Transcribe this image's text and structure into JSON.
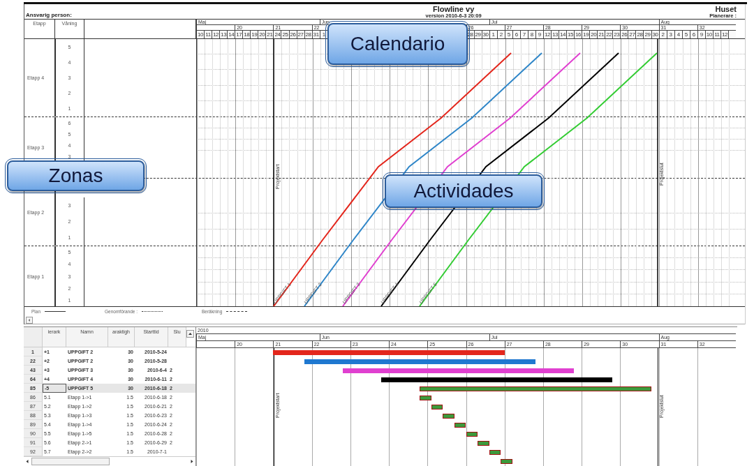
{
  "header": {
    "responsible": "Ansvarig person:",
    "title": "Flowline vy",
    "version": "version 2010-6-3 20:09",
    "project": "Huset",
    "planner": "Planerare :"
  },
  "flowline": {
    "columns": [
      "Etapp",
      "Våning"
    ],
    "months": [
      "Maj",
      "Jun",
      "Jul",
      "Aug"
    ],
    "weeks": [
      {
        "days": [
          "10",
          "11",
          "12",
          "13",
          "14"
        ]
      },
      {
        "label": "20",
        "days": [
          "17",
          "18",
          "19",
          "20",
          "21"
        ]
      },
      {
        "label": "21",
        "days": [
          "24",
          "25",
          "26",
          "27",
          "28"
        ]
      },
      {
        "label": "22",
        "days": [
          "31",
          "1"
        ]
      },
      {
        "label": "26",
        "days": [
          "28",
          "29",
          "30",
          "1",
          "2"
        ]
      },
      {
        "label": "27",
        "days": [
          "5",
          "6",
          "7",
          "8",
          "9"
        ]
      },
      {
        "label": "28",
        "days": [
          "12",
          "13",
          "14",
          "15",
          "16"
        ]
      },
      {
        "label": "29",
        "days": [
          "19",
          "20",
          "21",
          "22",
          "23"
        ]
      },
      {
        "label": "30",
        "days": [
          "26",
          "27",
          "28",
          "29",
          "30"
        ]
      },
      {
        "label": "31",
        "days": [
          "2",
          "3",
          "4",
          "5",
          "6"
        ]
      },
      {
        "label": "32",
        "days": [
          "9",
          "10",
          "11",
          "12"
        ]
      }
    ],
    "stages": [
      {
        "name": "Etapp 4",
        "floors": [
          "5",
          "4",
          "3",
          "2",
          "1"
        ]
      },
      {
        "name": "Etapp 3",
        "floors": [
          "6",
          "5",
          "4",
          "3"
        ]
      },
      {
        "name": "Etapp 2",
        "floors": [
          "3",
          "2",
          "1"
        ]
      },
      {
        "name": "Etapp 1",
        "floors": [
          "5",
          "4",
          "3",
          "2",
          "1"
        ]
      }
    ],
    "tasks": [
      {
        "name": "UPPGIFT 1",
        "color": "#e3261c"
      },
      {
        "name": "UPPGIFT 2",
        "color": "#2f86c8"
      },
      {
        "name": "UPPGIFT 3",
        "color": "#e040d0"
      },
      {
        "name": "UPPGIFT 4",
        "color": "#000000"
      },
      {
        "name": "UPPGIFT 5",
        "color": "#33cc33"
      }
    ],
    "milestones": [
      "Projektstart",
      "Projektslut"
    ],
    "legend": [
      {
        "label": "Plan",
        "kind": "solid"
      },
      {
        "label": "Genomförande :",
        "kind": "dotted"
      },
      {
        "label": "Beräkning",
        "kind": "dashed"
      }
    ]
  },
  "table": {
    "columns": [
      "ierark",
      "Namn",
      "araktigh",
      "Starttid",
      "Slu"
    ],
    "rows": [
      {
        "id": "1",
        "wbs": "+1",
        "name": "UPPGIFT 2",
        "duration": "30",
        "start": "2010-5-24",
        "kind": "summary",
        "selected": false
      },
      {
        "id": "22",
        "wbs": "+2",
        "name": "UPPGIFT 2",
        "duration": "30",
        "start": "2010-5-28",
        "kind": "summary",
        "selected": false
      },
      {
        "id": "43",
        "wbs": "+3",
        "name": "UPPGIFT 3",
        "duration": "30",
        "start": "2010-6-4",
        "end": "2",
        "kind": "summary",
        "selected": false
      },
      {
        "id": "64",
        "wbs": "+4",
        "name": "UPPGIFT 4",
        "duration": "30",
        "start": "2010-6-11",
        "end": "2",
        "kind": "summary",
        "selected": false
      },
      {
        "id": "85",
        "wbs": "-5",
        "name": "UPPGIFT 5",
        "duration": "30",
        "start": "2010-6-18",
        "end": "2",
        "kind": "summary",
        "selected": true
      },
      {
        "id": "86",
        "wbs": "5.1",
        "name": "Etapp 1->1",
        "duration": "1.5",
        "start": "2010-6-18",
        "end": "2",
        "kind": "task",
        "selected": false
      },
      {
        "id": "87",
        "wbs": "5.2",
        "name": "Etapp 1->2",
        "duration": "1.5",
        "start": "2010-6-21",
        "end": "2",
        "kind": "task",
        "selected": false
      },
      {
        "id": "88",
        "wbs": "5.3",
        "name": "Etapp 1->3",
        "duration": "1.5",
        "start": "2010-6-23",
        "end": "2",
        "kind": "task",
        "selected": false
      },
      {
        "id": "89",
        "wbs": "5.4",
        "name": "Etapp 1->4",
        "duration": "1.5",
        "start": "2010-6-24",
        "end": "2",
        "kind": "task",
        "selected": false
      },
      {
        "id": "90",
        "wbs": "5.5",
        "name": "Etapp 1->5",
        "duration": "1.5",
        "start": "2010-6-28",
        "end": "2",
        "kind": "task",
        "selected": false
      },
      {
        "id": "91",
        "wbs": "5.6",
        "name": "Etapp 2->1",
        "duration": "1.5",
        "start": "2010-6-29",
        "end": "2",
        "kind": "task",
        "selected": false
      },
      {
        "id": "92",
        "wbs": "5.7",
        "name": "Etapp 2->2",
        "duration": "1.5",
        "start": "2010-7-1",
        "kind": "task",
        "selected": false
      }
    ]
  },
  "gantt": {
    "year": "2010",
    "months": [
      "Maj",
      "Jun",
      "Jul",
      "Aug"
    ],
    "weeks": [
      "20",
      "21",
      "22",
      "23",
      "24",
      "25",
      "26",
      "27",
      "28",
      "29",
      "30",
      "31",
      "32"
    ],
    "milestones": [
      "Projektstart",
      "Projektslut"
    ],
    "bars": [
      {
        "color": "#e3261c",
        "kind": "summary"
      },
      {
        "color": "#1f78d0",
        "kind": "summary"
      },
      {
        "color": "#e040d0",
        "kind": "summary"
      },
      {
        "color": "#000000",
        "kind": "summary"
      },
      {
        "color": "#3c9a3c",
        "kind": "outlined"
      },
      {
        "color": "#3c9a3c",
        "kind": "outlined"
      },
      {
        "color": "#3c9a3c",
        "kind": "outlined"
      },
      {
        "color": "#3c9a3c",
        "kind": "outlined"
      },
      {
        "color": "#3c9a3c",
        "kind": "outlined"
      },
      {
        "color": "#3c9a3c",
        "kind": "outlined"
      },
      {
        "color": "#3c9a3c",
        "kind": "outlined"
      },
      {
        "color": "#3c9a3c",
        "kind": "outlined"
      },
      {
        "color": "#3c9a3c",
        "kind": "outlined"
      }
    ]
  },
  "callouts": [
    {
      "text": "Calendario",
      "kind": "calendar"
    },
    {
      "text": "Zonas",
      "kind": "zones"
    },
    {
      "text": "Actividades",
      "kind": "activities"
    }
  ]
}
